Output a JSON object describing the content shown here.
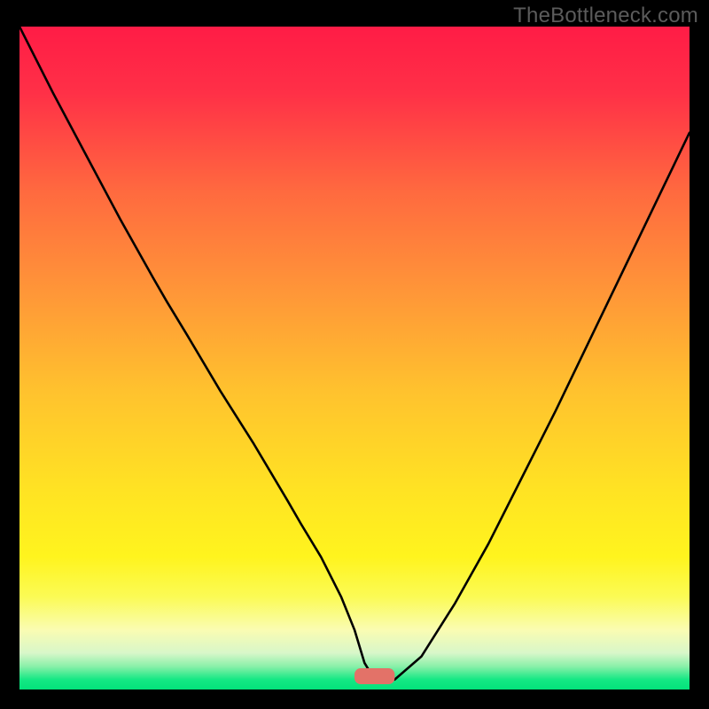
{
  "attribution": "TheBottleneck.com",
  "colors": {
    "background": "#000000",
    "gradient_stops": [
      {
        "offset": 0.0,
        "color": "#ff1c46"
      },
      {
        "offset": 0.1,
        "color": "#ff3047"
      },
      {
        "offset": 0.25,
        "color": "#ff6a3f"
      },
      {
        "offset": 0.4,
        "color": "#ff9638"
      },
      {
        "offset": 0.55,
        "color": "#ffc22e"
      },
      {
        "offset": 0.7,
        "color": "#ffe323"
      },
      {
        "offset": 0.8,
        "color": "#fff41e"
      },
      {
        "offset": 0.86,
        "color": "#fbfb55"
      },
      {
        "offset": 0.91,
        "color": "#fafcb2"
      },
      {
        "offset": 0.945,
        "color": "#d8f7c9"
      },
      {
        "offset": 0.965,
        "color": "#8af0a9"
      },
      {
        "offset": 0.985,
        "color": "#15e884"
      },
      {
        "offset": 1.0,
        "color": "#03e27b"
      }
    ],
    "curve": "#000000",
    "marker": "#e37268"
  },
  "chart_data": {
    "type": "line",
    "title": "",
    "xlabel": "",
    "ylabel": "",
    "xlim": [
      0,
      100
    ],
    "ylim": [
      0,
      100
    ],
    "series": [
      {
        "name": "bottleneck-curve",
        "x": [
          0,
          5,
          10,
          15,
          20,
          22,
          25,
          30,
          35,
          40,
          42,
          45,
          48,
          50,
          51.5,
          53,
          56,
          60,
          65,
          70,
          75,
          80,
          85,
          90,
          95,
          100
        ],
        "y": [
          100,
          90,
          80.5,
          71,
          62,
          58.5,
          53.5,
          45,
          37,
          28.5,
          25,
          20,
          14,
          9,
          4,
          1.5,
          1.5,
          5,
          13,
          22,
          32,
          42,
          52.5,
          63,
          73.5,
          84
        ]
      }
    ],
    "marker": {
      "x_center": 53,
      "y": 2.0,
      "width": 6,
      "height": 2.4
    }
  }
}
